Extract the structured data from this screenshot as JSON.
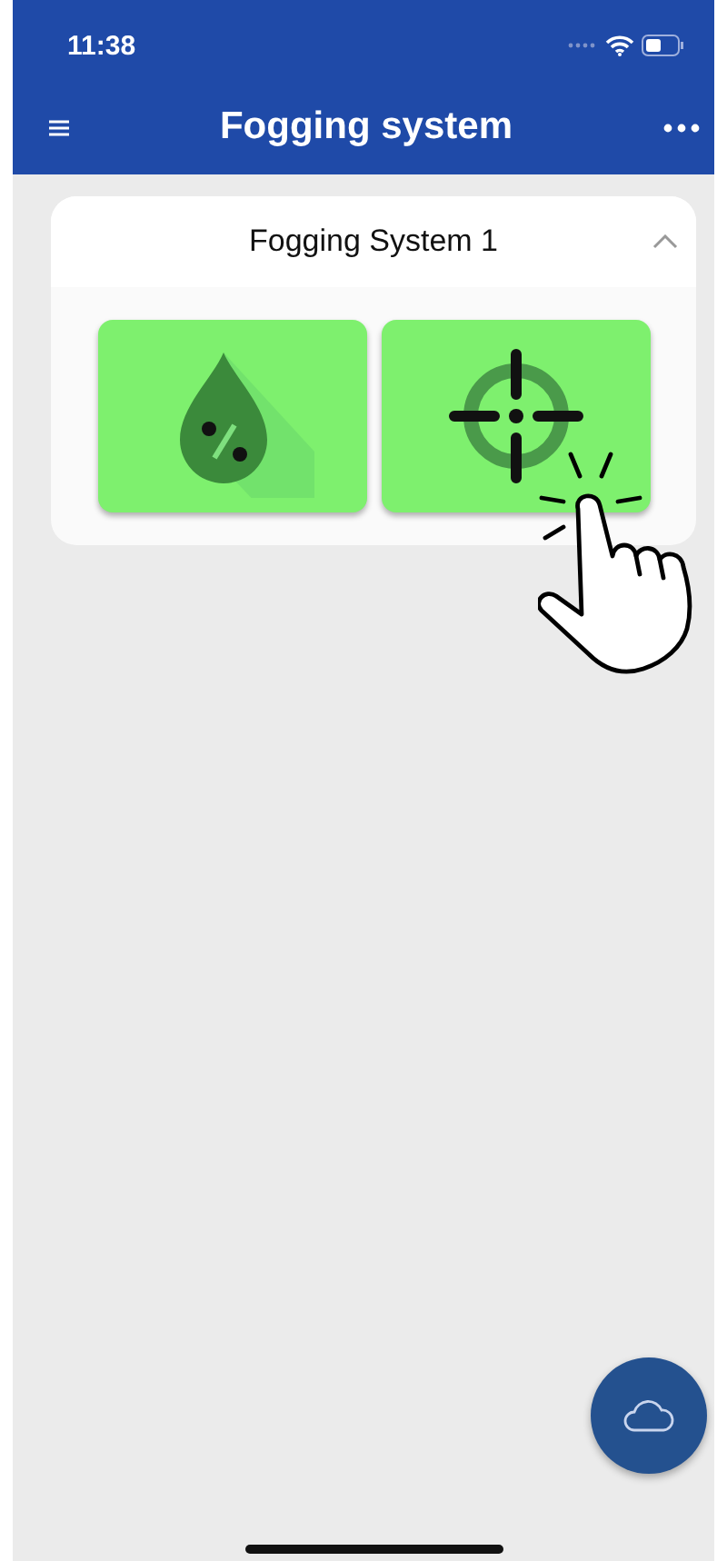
{
  "status_bar": {
    "time": "11:38"
  },
  "app_bar": {
    "title": "Fogging system"
  },
  "panel": {
    "title": "Fogging System 1",
    "expanded": true,
    "tiles": [
      {
        "kind": "humidity"
      },
      {
        "kind": "target"
      }
    ]
  }
}
